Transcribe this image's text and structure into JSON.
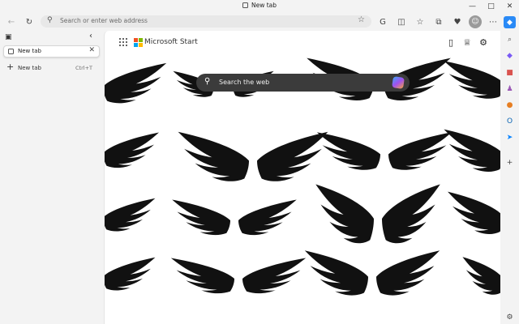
{
  "window": {
    "title": "New tab",
    "controls": [
      "—",
      "□",
      "✕"
    ]
  },
  "toolbar": {
    "back": "←",
    "refresh": "↻",
    "address_placeholder": "Search or enter web address",
    "icons": [
      "G",
      "◫",
      "☆",
      "⧉",
      "♥",
      "☺",
      "⋯"
    ]
  },
  "sidebar": {
    "tabs_icon": "▣",
    "collapse": "‹",
    "tabs": [
      {
        "label": "New tab",
        "close": "✕"
      }
    ],
    "new_tab": {
      "plus": "+",
      "label": "New tab",
      "shortcut": "Ctrl+T"
    }
  },
  "page": {
    "brand": "Microsoft Start",
    "search_placeholder": "Search the web",
    "header_icons": [
      "▯",
      "♕",
      "⚙"
    ]
  },
  "right_bar": {
    "icons": [
      {
        "name": "copilot-icon",
        "glyph": "◆",
        "color": "#2a8af6"
      },
      {
        "name": "search-icon",
        "glyph": "⌕",
        "color": "#555555"
      },
      {
        "name": "tag-icon",
        "glyph": "◆",
        "color": "#7a5af5"
      },
      {
        "name": "toolbox-icon",
        "glyph": "■",
        "color": "#d9534f"
      },
      {
        "name": "games-icon",
        "glyph": "♟",
        "color": "#9b59b6"
      },
      {
        "name": "office-icon",
        "glyph": "●",
        "color": "#e67e22"
      },
      {
        "name": "outlook-icon",
        "glyph": "O",
        "color": "#0a64b4"
      },
      {
        "name": "send-icon",
        "glyph": "➤",
        "color": "#0a84ff"
      },
      {
        "name": "add-icon",
        "glyph": "+",
        "color": "#444444"
      },
      {
        "name": "settings-icon",
        "glyph": "⚙",
        "color": "#444444"
      }
    ]
  },
  "colors": {
    "ms_logo": [
      "#f25022",
      "#7fba00",
      "#00a4ef",
      "#ffb900"
    ]
  }
}
